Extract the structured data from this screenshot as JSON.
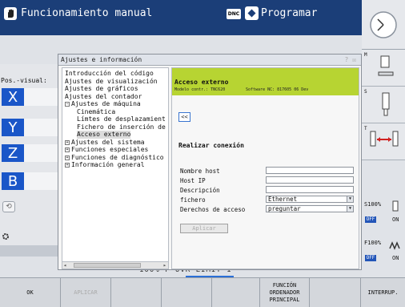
{
  "header": {
    "mode_title": "Funcionamiento manual",
    "dnc_label": "DNC",
    "program_title": "Programar"
  },
  "left_panel": {
    "pos_label": "Pos.-visual:",
    "axes": [
      "X",
      "Y",
      "Z",
      "B"
    ],
    "small_button_glyph": "⟲"
  },
  "background_text": "100% F OVR   LIMIT 1",
  "dialog": {
    "title": "Ajustes e información",
    "controls": "? ☒",
    "tree": [
      {
        "label": "Introducción del código",
        "indent": 0,
        "expander": ""
      },
      {
        "label": "Ajustes de visualización",
        "indent": 0,
        "expander": ""
      },
      {
        "label": "Ajustes de gráficos",
        "indent": 0,
        "expander": ""
      },
      {
        "label": "Ajustes del contador",
        "indent": 0,
        "expander": ""
      },
      {
        "label": "Ajustes de máquina",
        "indent": 0,
        "expander": "−"
      },
      {
        "label": "Cinemática",
        "indent": 1,
        "expander": ""
      },
      {
        "label": "Límtes de desplazamient",
        "indent": 1,
        "expander": ""
      },
      {
        "label": "Fichero de inserción de",
        "indent": 1,
        "expander": ""
      },
      {
        "label": "Acceso externo",
        "indent": 1,
        "expander": "",
        "selected": true
      },
      {
        "label": "Ajustes del sistema",
        "indent": 0,
        "expander": "+"
      },
      {
        "label": "Funciones especiales",
        "indent": 0,
        "expander": "+"
      },
      {
        "label": "Funciones de diagnóstico",
        "indent": 0,
        "expander": "+"
      },
      {
        "label": "Información general",
        "indent": 0,
        "expander": "+"
      }
    ],
    "content": {
      "header_title": "Acceso externo",
      "model_text": "Modelo contr.: TNC620",
      "software_text": "Software NC: 817605 06 Dev",
      "back_label": "<<",
      "section_title": "Realizar conexión",
      "fields": [
        {
          "label": "Nombre host",
          "value": ""
        },
        {
          "label": "Host IP",
          "value": ""
        },
        {
          "label": "Descripción",
          "value": ""
        },
        {
          "label": "fichero",
          "value": "Ethernet",
          "select": true
        },
        {
          "label": "Derechos de acceso",
          "value": "preguntar",
          "select": true
        }
      ],
      "apply_label": "Aplicar"
    }
  },
  "right_panel": {
    "tiles": [
      "M",
      "S",
      "T"
    ],
    "spindle": {
      "value": "S100%",
      "off": "OFF",
      "on": "ON"
    },
    "feed": {
      "value": "F100%",
      "off": "OFF",
      "on": "ON"
    }
  },
  "softkeys": [
    {
      "label": "OK",
      "disabled": false
    },
    {
      "label": "APLICAR",
      "disabled": true
    },
    {
      "label": "",
      "disabled": false
    },
    {
      "label": "",
      "disabled": false
    },
    {
      "label": "",
      "disabled": false
    },
    {
      "label": "FUNCIÓN ORDENADOR PRINCIPAL",
      "disabled": false
    },
    {
      "label": "",
      "disabled": false
    },
    {
      "label": "INTERRUP.",
      "disabled": false
    }
  ],
  "colors": {
    "header_blue": "#1b3e78",
    "axis_blue": "#1a56c8",
    "content_header_green": "#b7d432"
  }
}
